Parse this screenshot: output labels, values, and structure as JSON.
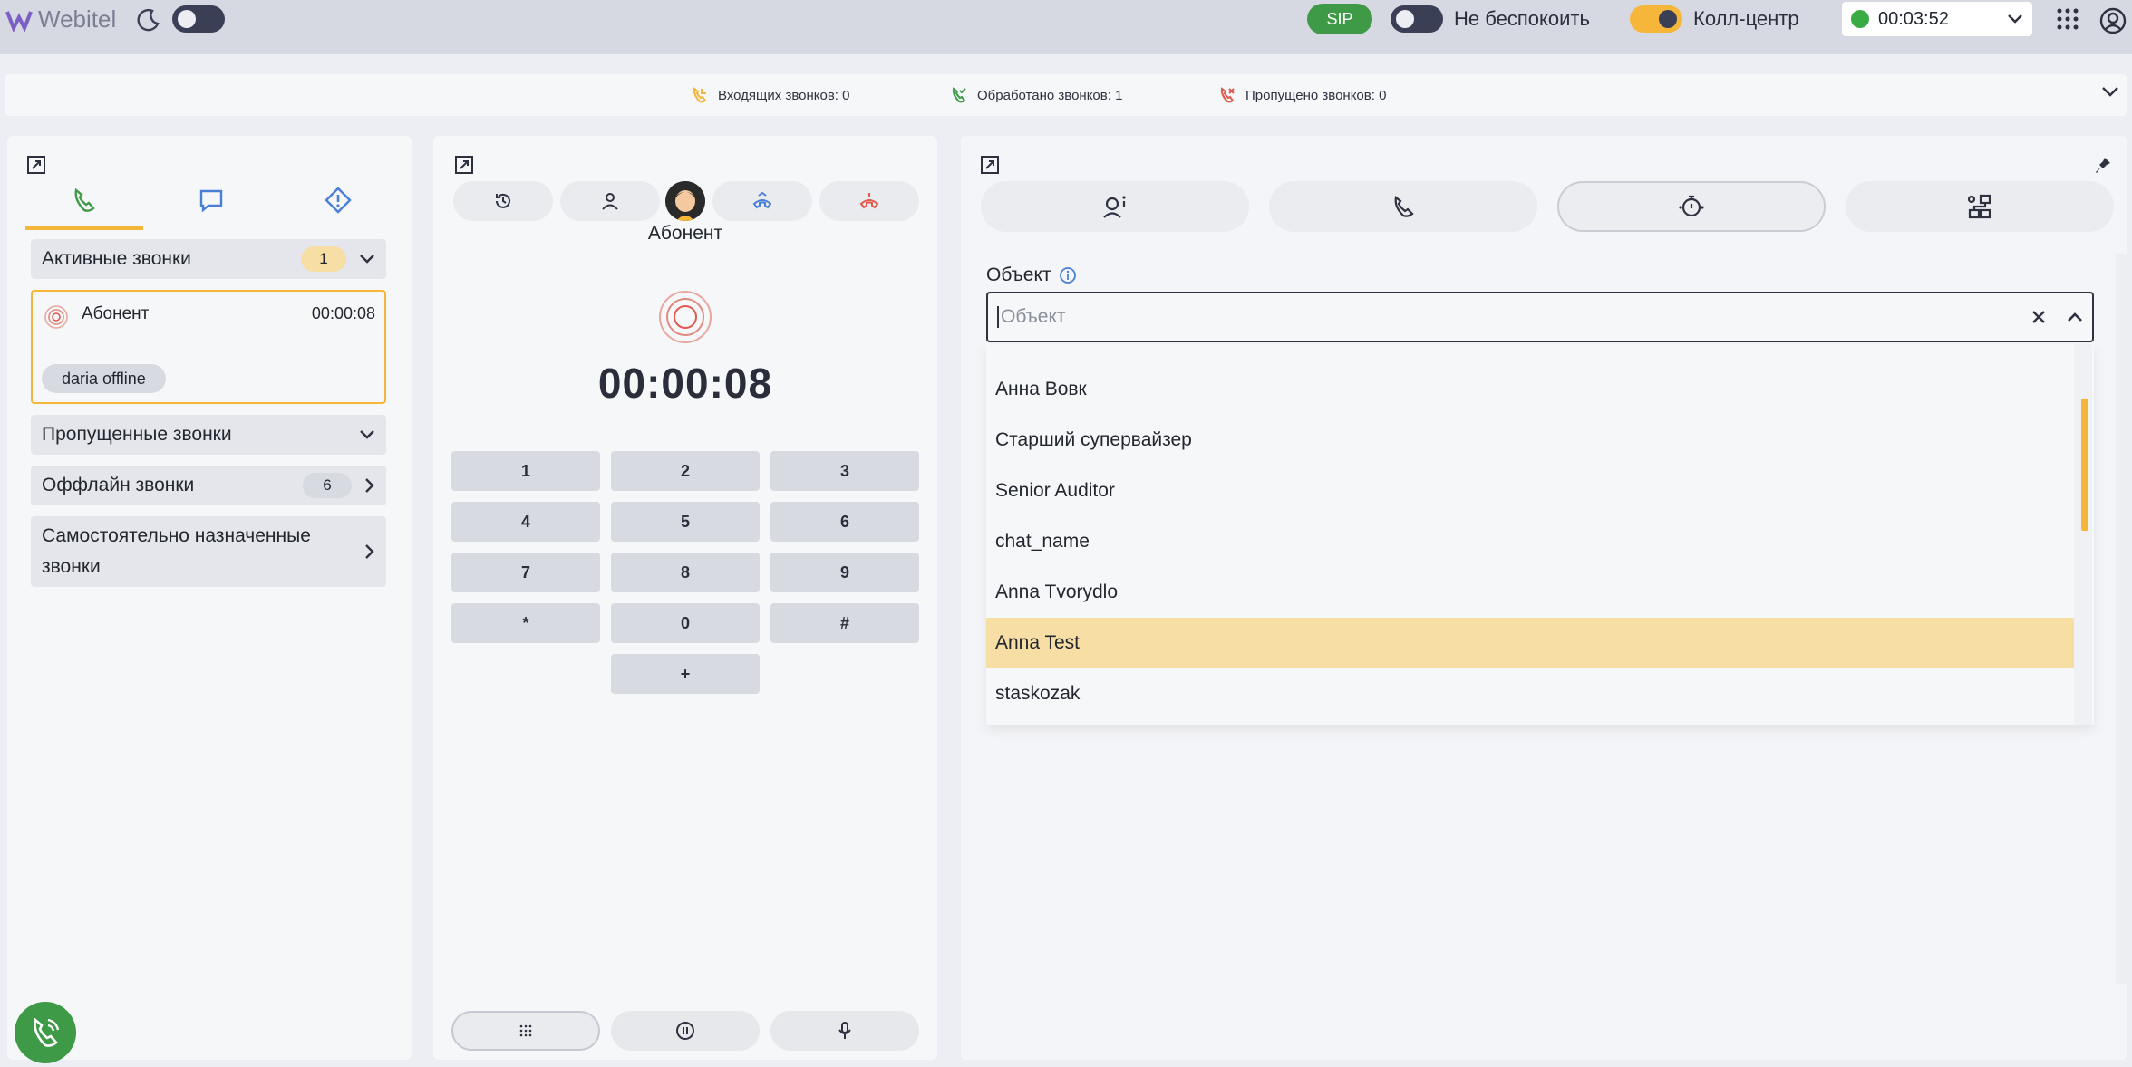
{
  "header": {
    "logo_text": "Webitel",
    "sip_label": "SIP",
    "dnd_label": "Не беспокоить",
    "callcenter_label": "Колл-центр",
    "status_timer": "00:03:52",
    "colors": {
      "accent": "#f5b63a",
      "green": "#3f9a48",
      "red": "#e05a4e",
      "blue": "#4a7fd6"
    }
  },
  "stats": {
    "incoming": "Входящих звонков: 0",
    "handled": "Обработано звонков: 1",
    "missed": "Пропущено звонков: 0"
  },
  "left": {
    "active_label": "Активные звонки",
    "active_count": "1",
    "call": {
      "name": "Абонент",
      "time": "00:00:08",
      "chip": "daria offline"
    },
    "missed_label": "Пропущенные звонки",
    "offline_label": "Оффлайн звонки",
    "offline_count": "6",
    "assigned_label": "Самостоятельно назначенные звонки"
  },
  "middle": {
    "subscriber": "Абонент",
    "timer": "00:00:08",
    "keys": [
      "1",
      "2",
      "3",
      "4",
      "5",
      "6",
      "7",
      "8",
      "9",
      "*",
      "0",
      "#",
      "+"
    ]
  },
  "right": {
    "object_label": "Объект",
    "object_placeholder": "Объект",
    "options": [
      "Анна Вовк",
      "Старший супервайзер",
      "Senior Auditor",
      "chat_name",
      "Anna Tvorydlo",
      "Anna Test",
      "staskozak"
    ],
    "selected_option": "Anna Test"
  }
}
